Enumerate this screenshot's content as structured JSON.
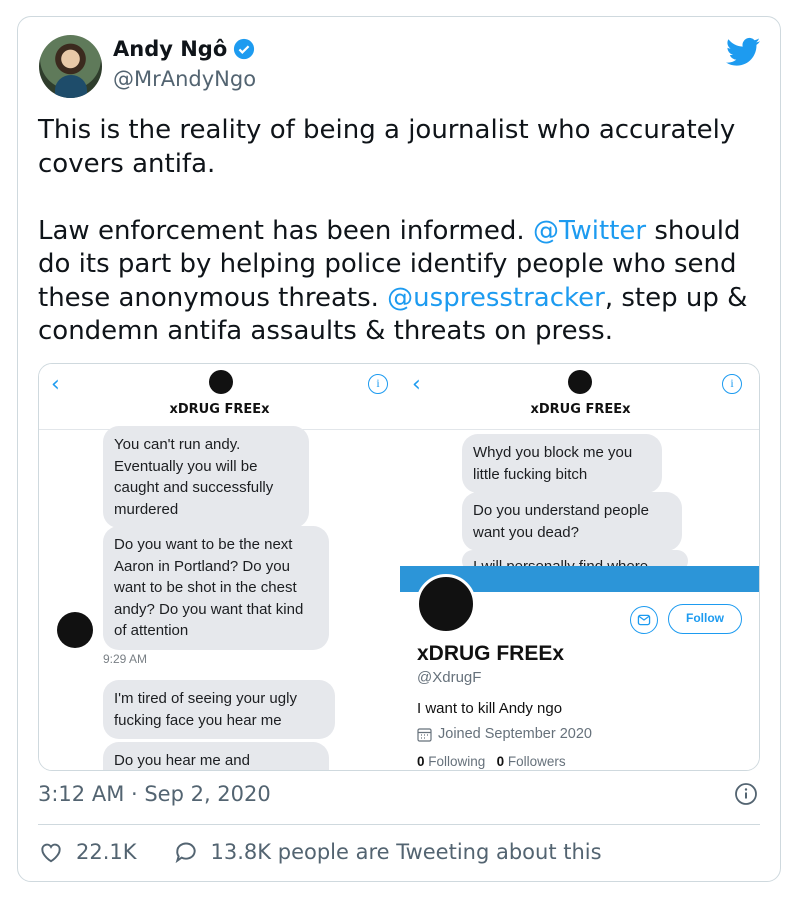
{
  "author": {
    "name": "Andy Ngô",
    "handle": "@MrAndyNgo"
  },
  "tweet": {
    "p1": "This is the reality of being a journalist who accurately covers antifa.",
    "p2a": "Law enforcement has been informed. ",
    "m1": "@Twitter",
    "p2b": " should do its part by helping police identify people who send these anonymous threats. ",
    "m2": "@uspresstracker",
    "p2c": ", step up & condemn antifa assaults & threats on press."
  },
  "media": {
    "left": {
      "title": "xDRUG FREEx",
      "messages": [
        "You can't run andy. Eventually you will be caught and successfully murdered",
        "Do you want to be the next Aaron in Portland? Do you want to be shot in the chest andy? Do you want that kind of attention",
        "I'm tired of seeing your ugly fucking face you hear me",
        "Do you hear me and"
      ],
      "time": "9:29 AM"
    },
    "right": {
      "title": "xDRUG FREEx",
      "messages": [
        "Whyd you block me you little fucking bitch",
        "Do you understand people want you dead?",
        "I will personally find where"
      ],
      "profile": {
        "name": "xDRUG FREEx",
        "handle": "@XdrugF",
        "bio": "I want to kill Andy ngo",
        "joined": "Joined September 2020",
        "following_count": "0",
        "following_label": "Following",
        "followers_count": "0",
        "followers_label": "Followers",
        "follow_button": "Follow"
      }
    }
  },
  "meta": {
    "timestamp": "3:12 AM · Sep 2, 2020"
  },
  "actions": {
    "likes": "22.1K",
    "replies": "13.8K people are Tweeting about this"
  },
  "colors": {
    "accent": "#1d9bf0",
    "text": "#0f1419",
    "muted": "#536471"
  }
}
